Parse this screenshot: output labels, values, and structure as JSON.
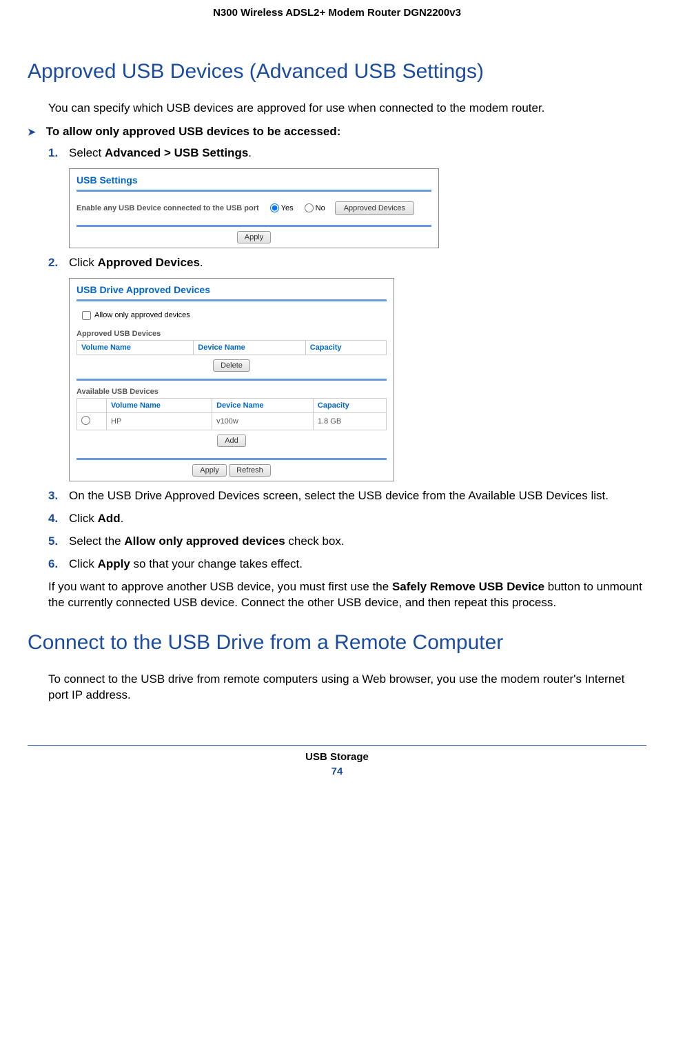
{
  "header": {
    "product": "N300 Wireless ADSL2+ Modem Router DGN2200v3"
  },
  "section1": {
    "heading": "Approved USB Devices (Advanced USB Settings)",
    "intro": "You can specify which USB devices are approved for use when connected to the modem router.",
    "task": "To allow only approved USB devices to be accessed:",
    "step1_pre": "Select ",
    "step1_bold": "Advanced > USB Settings",
    "step1_post": ".",
    "step2_pre": "Click ",
    "step2_bold": "Approved Devices",
    "step2_post": ".",
    "step3": "On the USB Drive Approved Devices screen, select the USB device from the Available USB Devices list.",
    "step4_pre": "Click ",
    "step4_bold": "Add",
    "step4_post": ".",
    "step5_pre": "Select the ",
    "step5_bold": "Allow only approved devices",
    "step5_post": " check box.",
    "step6_pre": "Click ",
    "step6_bold": "Apply",
    "step6_post": " so that your change takes effect.",
    "note_pre": "If you want to approve another USB device, you must first use the ",
    "note_bold": "Safely Remove USB Device",
    "note_post": " button to unmount the currently connected USB device. Connect the other USB device, and then repeat this process."
  },
  "screenshot1": {
    "title": "USB Settings",
    "label": "Enable any USB Device connected to the USB port",
    "yes": "Yes",
    "no": "No",
    "approved_btn": "Approved Devices",
    "apply": "Apply"
  },
  "screenshot2": {
    "title": "USB Drive Approved Devices",
    "checkbox_label": "Allow only approved devices",
    "approved_heading": "Approved USB Devices",
    "col_volume": "Volume Name",
    "col_device": "Device Name",
    "col_capacity": "Capacity",
    "delete": "Delete",
    "available_heading": "Available USB Devices",
    "row_volume": "HP",
    "row_device": "v100w",
    "row_capacity": "1.8 GB",
    "add": "Add",
    "apply": "Apply",
    "refresh": "Refresh"
  },
  "section2": {
    "heading": "Connect to the USB Drive from a Remote Computer",
    "intro": "To connect to the USB drive from remote computers using a Web browser, you use the modem router's Internet port IP address."
  },
  "footer": {
    "section": "USB Storage",
    "page": "74"
  },
  "nums": {
    "n1": "1.",
    "n2": "2.",
    "n3": "3.",
    "n4": "4.",
    "n5": "5.",
    "n6": "6."
  }
}
